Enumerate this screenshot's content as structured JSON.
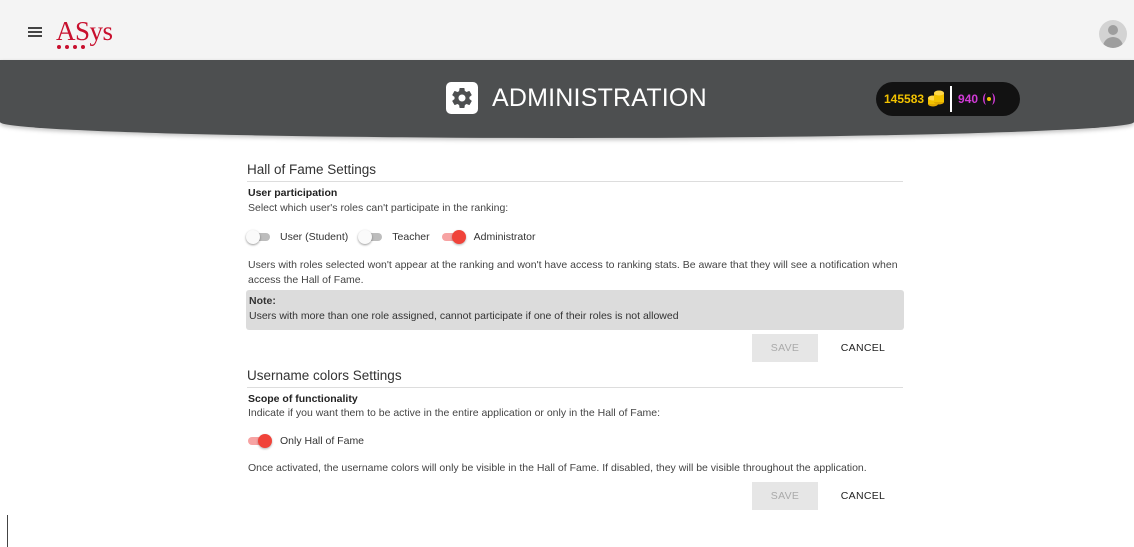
{
  "app": {
    "logo_text": "ASys",
    "menu_icon": "hamburger-menu-icon",
    "avatar_icon": "user-avatar-icon"
  },
  "header": {
    "title": "ADMINISTRATION",
    "icon": "gear-icon",
    "coins": "145583",
    "coins_icon": "coin-stack-icon",
    "gems": "940",
    "gems_icon": "gem-icon",
    "colors": {
      "band": "#4d4f50",
      "coins": "#f2c200",
      "gems": "#d13bd6"
    }
  },
  "hall_of_fame": {
    "title": "Hall of Fame Settings",
    "subtitle": "User participation",
    "description": "Select which user's roles can't participate in the ranking:",
    "toggles": [
      {
        "label": "User (Student)",
        "on": false
      },
      {
        "label": "Teacher",
        "on": false
      },
      {
        "label": "Administrator",
        "on": true
      }
    ],
    "info": "Users with roles selected won't appear at the ranking and won't have access to ranking stats. Be aware that they will see a notification when access the Hall of Fame.",
    "note_title": "Note:",
    "note_text": "Users with more than one role assigned, cannot participate if one of their roles is not allowed",
    "save_label": "SAVE",
    "cancel_label": "CANCEL"
  },
  "username_colors": {
    "title": "Username colors Settings",
    "subtitle": "Scope of functionality",
    "description": "Indicate if you want them to be active in the entire application or only in the Hall of Fame:",
    "toggle": {
      "label": "Only Hall of Fame",
      "on": true
    },
    "info": "Once activated, the username colors will only be visible in the Hall of Fame. If disabled, they will be visible throughout the application.",
    "save_label": "SAVE",
    "cancel_label": "CANCEL"
  },
  "accent_color": "#f0433a"
}
